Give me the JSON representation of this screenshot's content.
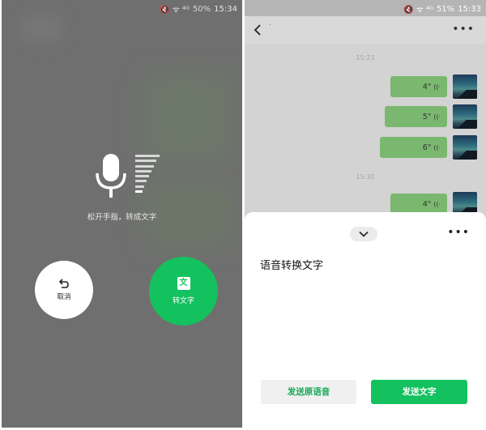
{
  "left": {
    "status": {
      "indicators": "🔇 ᯤ ⁴ᴳ",
      "battery": "50%",
      "time": "15:34"
    },
    "hint": "松开手指，转成文字",
    "cancel_label": "取消",
    "to_text_label": "转文字",
    "to_text_icon_char": "文",
    "mic_icon": "microphone-icon",
    "undo_icon": "undo-arrow-icon"
  },
  "right": {
    "status": {
      "indicators": "🔇 ᯤ ⁴ᴳ",
      "battery": "51%",
      "time": "15:33"
    },
    "chat_title": "·",
    "messages": [
      {
        "time": "15:23"
      },
      {
        "duration": "4\""
      },
      {
        "duration": "5\""
      },
      {
        "duration": "6\""
      },
      {
        "time": "15:31"
      },
      {
        "duration": "4\""
      }
    ],
    "sheet": {
      "transcript": "语音转换文字",
      "send_original_label": "发送原语音",
      "send_text_label": "发送文字"
    },
    "colors": {
      "green": "#14c15f",
      "bubble": "#7ab86f"
    }
  }
}
